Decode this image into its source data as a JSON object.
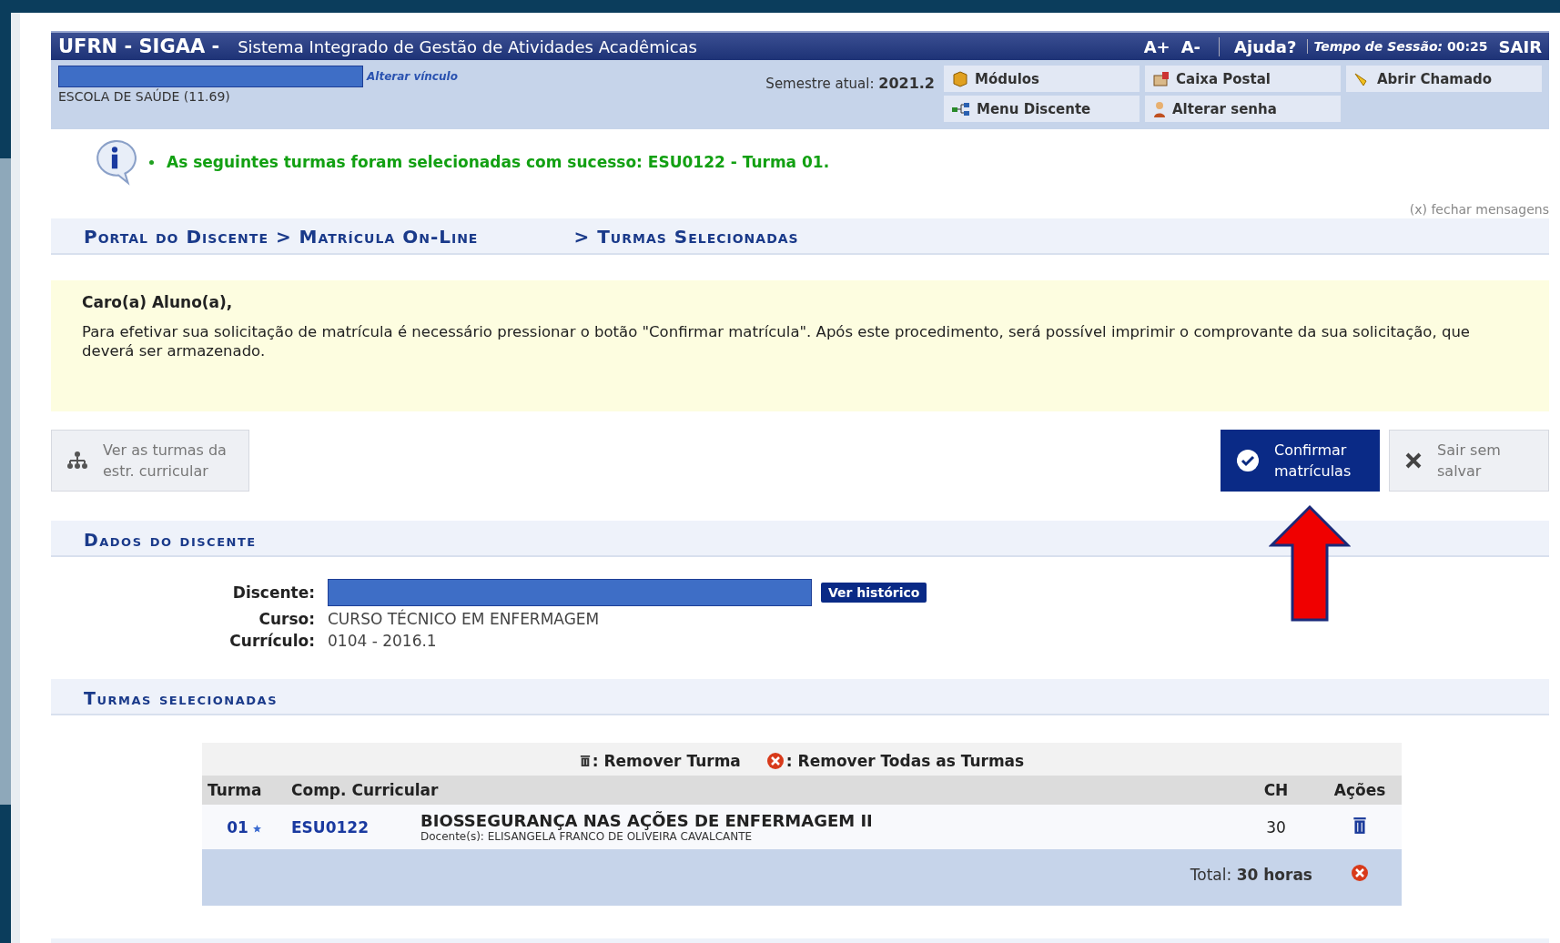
{
  "header": {
    "title": "UFRN - SIGAA -",
    "subtitle": "Sistema Integrado de Gestão de Atividades Acadêmicas",
    "font_up": "A+",
    "font_down": "A-",
    "help": "Ajuda?",
    "session_label": "Tempo de Sessão:",
    "session_time": "00:25",
    "logout": "SAIR"
  },
  "info_bar": {
    "change_link": "Alterar vínculo",
    "unit": "ESCOLA DE SAÚDE (11.69)",
    "semester_label": "Semestre atual:",
    "semester": "2021.2",
    "menu": [
      {
        "kind": "cube",
        "label": "Módulos"
      },
      {
        "kind": "mail",
        "label": "Caixa Postal"
      },
      {
        "kind": "horn",
        "label": "Abrir Chamado"
      },
      {
        "kind": "tree",
        "label": "Menu Discente"
      },
      {
        "kind": "person",
        "label": "Alterar senha"
      }
    ]
  },
  "message": {
    "text": "As seguintes turmas foram selecionadas com sucesso: ESU0122 - Turma 01.",
    "close": "(x) fechar mensagens"
  },
  "breadcrumb": [
    "Portal do Discente > Matrícula On-Line",
    "> Turmas Selecionadas"
  ],
  "notice": {
    "greeting": "Caro(a) Aluno(a),",
    "text": "Para efetivar sua solicitação de matrícula é necessário pressionar o botão \"Confirmar matrícula\". Após este procedimento, será possível imprimir o comprovante da sua solicitação, que deverá ser armazenado."
  },
  "actions": [
    {
      "kind": "tree",
      "label": "Ver as turmas da estr. curricular",
      "primary": false
    },
    {
      "kind": "check",
      "label": "Confirmar matrículas",
      "primary": true
    },
    {
      "kind": "cross",
      "label": "Sair sem salvar",
      "primary": false
    }
  ],
  "student": {
    "title": "Dados do discente",
    "fields": [
      {
        "label": "Discente:",
        "kind": "redacted",
        "button": "Ver histórico"
      },
      {
        "label": "Curso:",
        "value": "CURSO TÉCNICO EM ENFERMAGEM"
      },
      {
        "label": "Currículo:",
        "value": "0104 - 2016.1"
      }
    ]
  },
  "classes": {
    "title": "Turmas selecionadas",
    "legend": [
      {
        "kind": "trash",
        "label": ": Remover Turma"
      },
      {
        "kind": "remove",
        "label": ": Remover Todas as Turmas"
      }
    ],
    "columns": [
      "Turma",
      "Comp. Curricular",
      "CH",
      "Ações"
    ],
    "rows": [
      {
        "turma": "01",
        "code": "ESU0122",
        "name": "BIOSSEGURANÇA NAS AÇÕES DE ENFERMAGEM II",
        "teacher": "Docente(s): ELISANGELA FRANCO DE OLIVEIRA CAVALCANTE",
        "ch": "30"
      }
    ],
    "total_label": "Total:",
    "total": "30 horas"
  }
}
